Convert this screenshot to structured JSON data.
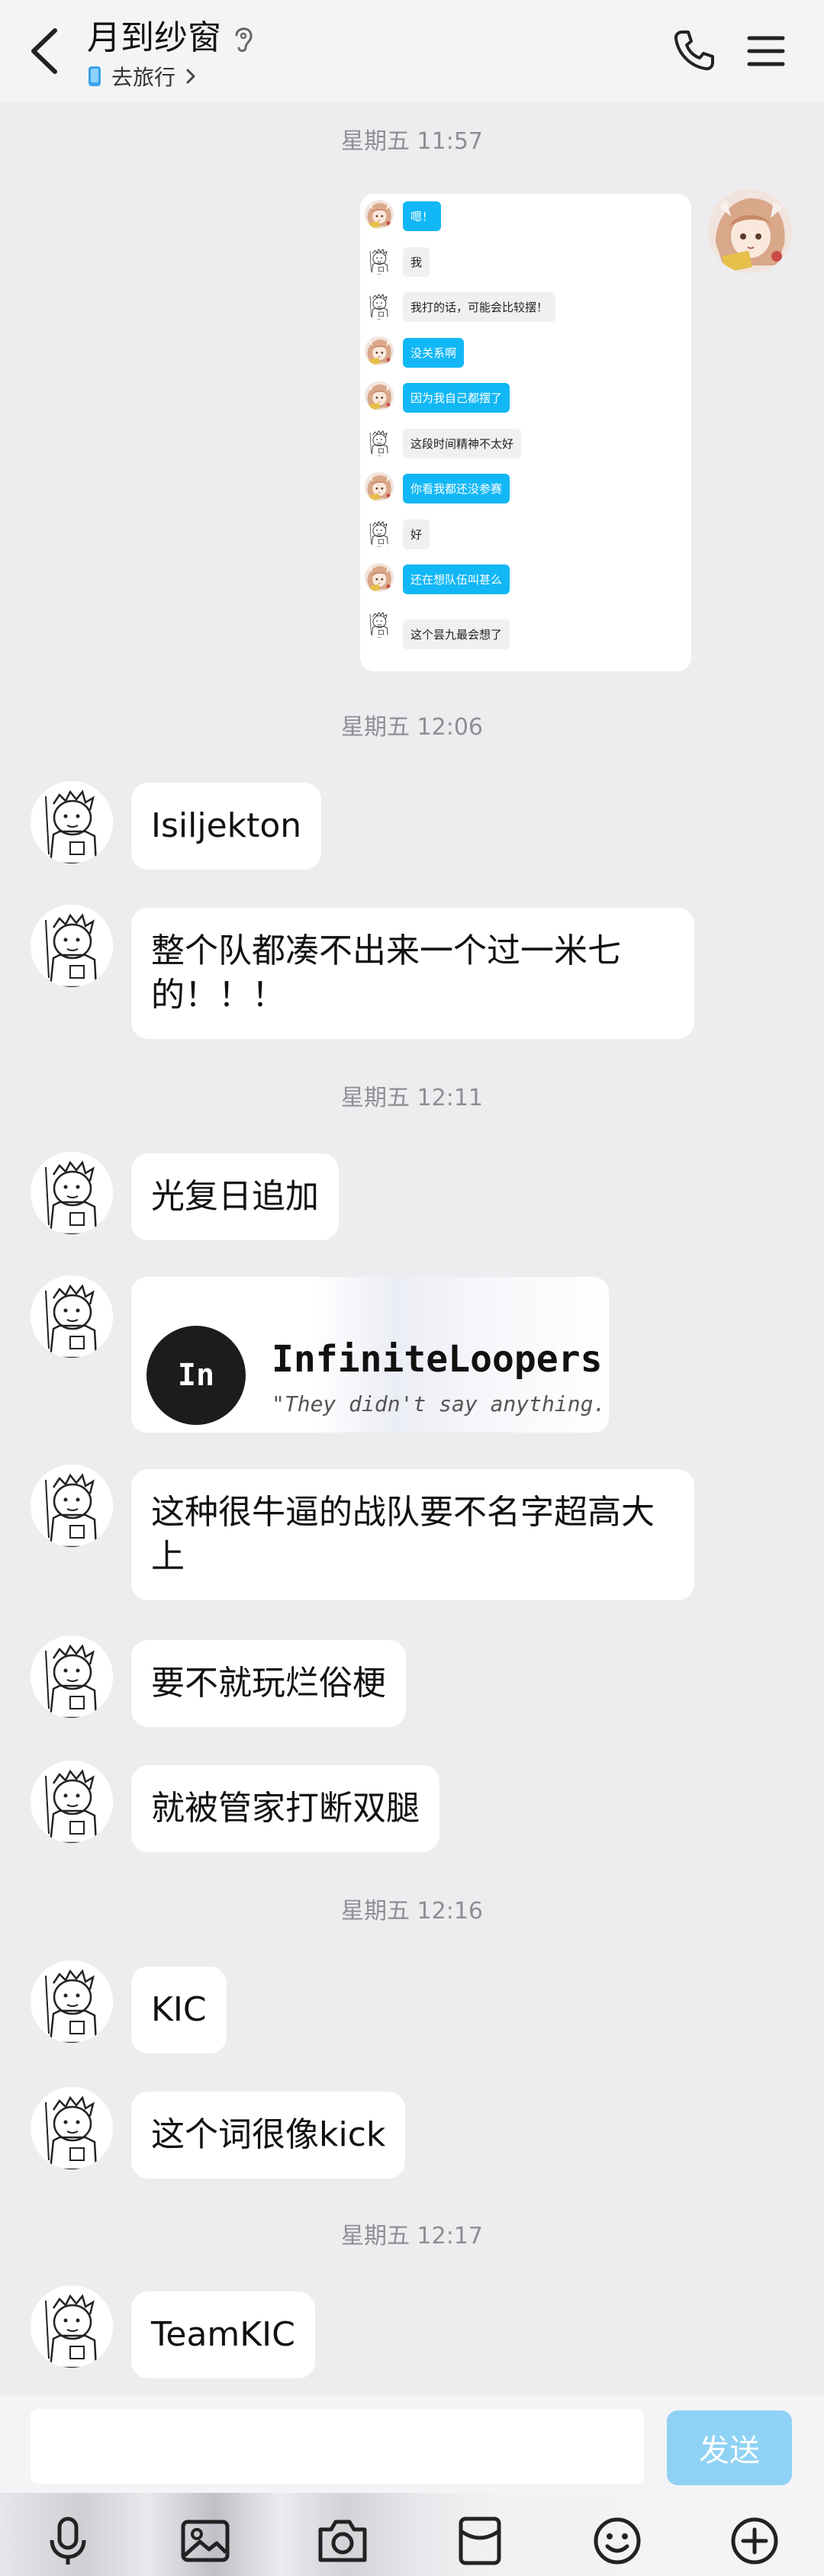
{
  "header": {
    "title": "月到纱窗",
    "status": "去旅行"
  },
  "screenshot": {
    "messages": [
      {
        "side": "a",
        "text": "嗯！"
      },
      {
        "side": "b",
        "text": "我"
      },
      {
        "side": "b",
        "text": "我打的话，可能会比较摆！"
      },
      {
        "side": "a",
        "text": "没关系啊"
      },
      {
        "side": "a",
        "text": "因为我自己都摆了"
      },
      {
        "side": "b",
        "text": "这段时间精神不太好"
      },
      {
        "side": "a",
        "text": "你看我都还没参赛"
      },
      {
        "side": "b",
        "text": "好"
      },
      {
        "side": "a",
        "text": "还在想队伍叫甚么"
      },
      {
        "side": "b",
        "text": "这个昙九最会想了"
      }
    ]
  },
  "timestamps": [
    "星期五 11:57",
    "星期五 12:06",
    "星期五 12:11",
    "星期五 12:16",
    "星期五 12:17"
  ],
  "messages": {
    "m1": "Isiljekton",
    "m2_l1": "整个队都凑不出来一个过一米七",
    "m2_l2": "的！！！",
    "m3": "光复日追加",
    "m5_l1": "这种很牛逼的战队要不名字超高大",
    "m5_l2": "上",
    "m6": "要不就玩烂俗梗",
    "m7": "就被管家打断双腿",
    "m8": "KIC",
    "m9": "这个词很像kick",
    "m10": "TeamKIC"
  },
  "card": {
    "logo_text": "In",
    "name": "InfiniteLoopers",
    "slogan": "\"They didn't say anything."
  },
  "input": {
    "send_label": "发送"
  },
  "colors": {
    "accent": "#12b7f5",
    "send_disabled": "#8fd2f5",
    "background": "#ededf0"
  }
}
